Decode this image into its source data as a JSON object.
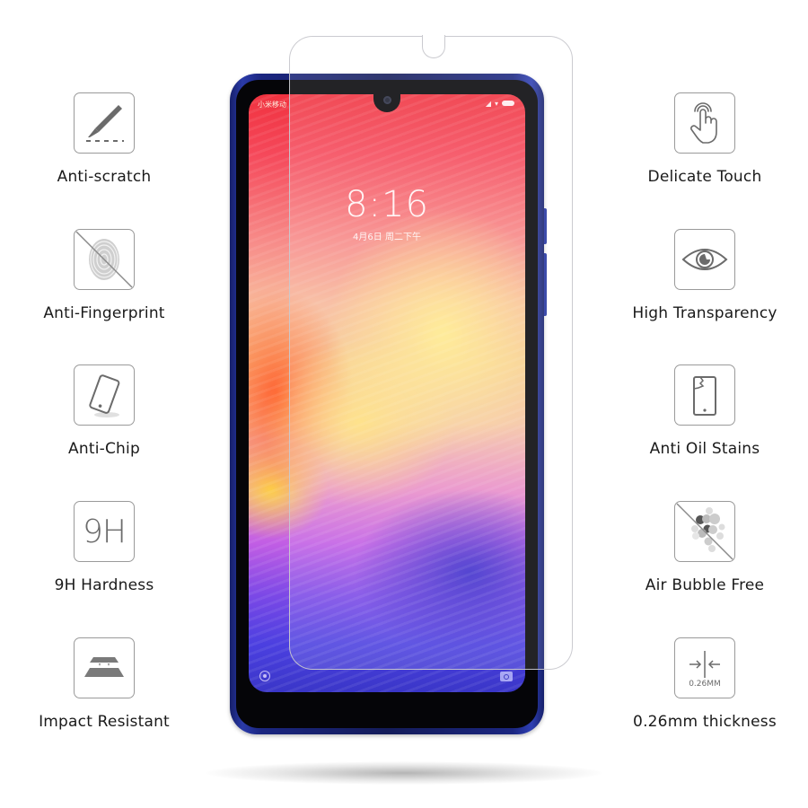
{
  "features_left": [
    {
      "label": "Anti-scratch",
      "icon": "scalpel-icon"
    },
    {
      "label": "Anti-Fingerprint",
      "icon": "fingerprint-crossed-icon"
    },
    {
      "label": "Anti-Chip",
      "icon": "tilted-phone-icon"
    },
    {
      "label": "9H Hardness",
      "icon": "9h-icon",
      "icon_text": "9H"
    },
    {
      "label": "Impact Resistant",
      "icon": "layers-icon"
    }
  ],
  "features_right": [
    {
      "label": "Delicate Touch",
      "icon": "touch-hand-icon"
    },
    {
      "label": "High Transparency",
      "icon": "eye-icon"
    },
    {
      "label": "Anti Oil Stains",
      "icon": "cracked-phone-icon"
    },
    {
      "label": "Air Bubble Free",
      "icon": "bubbles-crossed-icon"
    },
    {
      "label": "0.26mm thickness",
      "icon": "thickness-arrows-icon",
      "icon_text": "0.26MM"
    }
  ],
  "phone": {
    "carrier": "小米移动",
    "time": "8:16",
    "date": "4月6日 周二下午"
  },
  "colors": {
    "icon_gray": "#6b6b6b",
    "phone_body": "#1b2680"
  }
}
